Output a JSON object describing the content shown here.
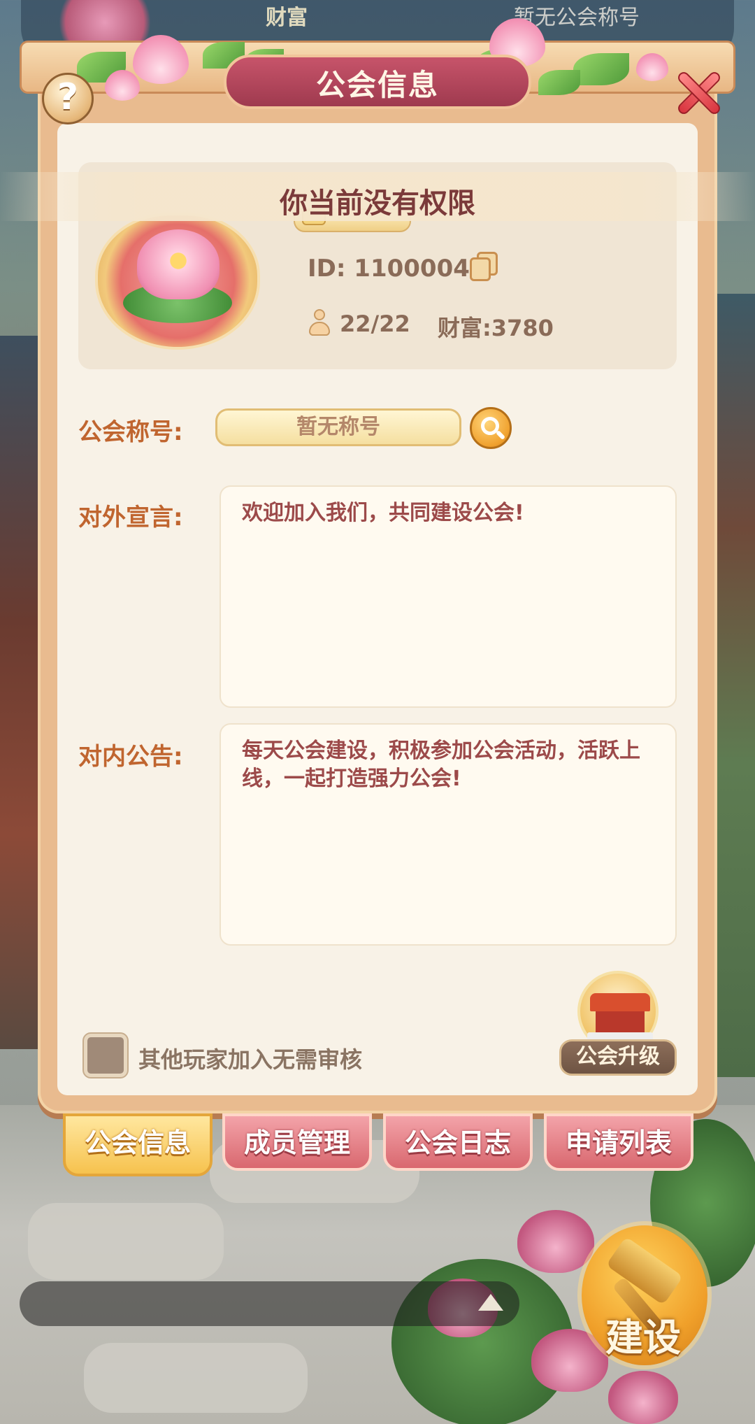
{
  "background": {
    "top_guild_title": "暂无公会称号",
    "top_name_fragment": "财富"
  },
  "dialog": {
    "title": "公会信息",
    "help_label": "?",
    "notice": "你当前没有权限"
  },
  "guild": {
    "id_text": "ID: 1100004",
    "members": "22/22",
    "wealth": "财富:3780"
  },
  "form": {
    "title_label": "公会称号:",
    "title_value": "暂无称号",
    "declaration_label": "对外宣言:",
    "declaration_text": "欢迎加入我们，共同建设公会!",
    "announcement_label": "对内公告:",
    "announcement_text": "每天公会建设，积极参加公会活动，活跃上线，一起打造强力公会!",
    "no_review_label": "其他玩家加入无需审核",
    "no_review_checked": false,
    "upgrade_label": "公会升级"
  },
  "tabs": [
    {
      "label": "公会信息",
      "active": true
    },
    {
      "label": "成员管理",
      "active": false
    },
    {
      "label": "公会日志",
      "active": false
    },
    {
      "label": "申请列表",
      "active": false
    }
  ],
  "build_button": {
    "label": "建设"
  },
  "colors": {
    "title_plate": "#b3475c",
    "label_orange": "#c0652f",
    "text_red": "#9c4a4a",
    "tab_active": "#f6c24e",
    "tab_inactive": "#d9686f"
  }
}
